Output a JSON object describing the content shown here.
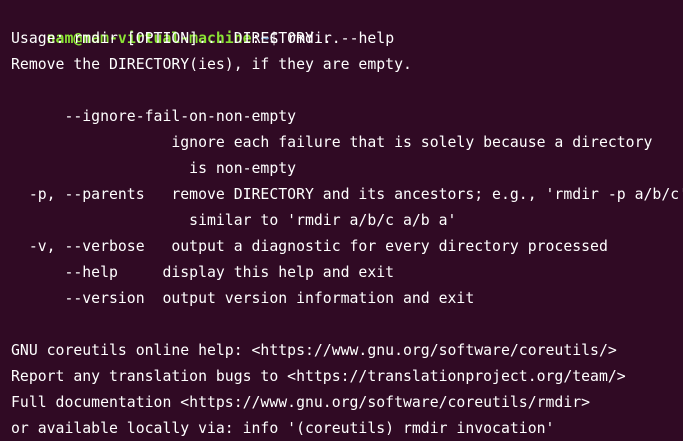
{
  "prompt": {
    "user_host": "nam@nam-virtual-machine",
    "separator": ":",
    "path": "~",
    "symbol": "$",
    "command": " rmdir --help"
  },
  "output_lines": [
    "Usage: rmdir [OPTION]... DIRECTORY...",
    "Remove the DIRECTORY(ies), if they are empty.",
    "",
    "      --ignore-fail-on-non-empty",
    "                  ignore each failure that is solely because a directory",
    "                    is non-empty",
    "  -p, --parents   remove DIRECTORY and its ancestors; e.g., 'rmdir -p a/b/c' is",
    "                    similar to 'rmdir a/b/c a/b a'",
    "  -v, --verbose   output a diagnostic for every directory processed",
    "      --help     display this help and exit",
    "      --version  output version information and exit",
    "",
    "GNU coreutils online help: <https://www.gnu.org/software/coreutils/>",
    "Report any translation bugs to <https://translationproject.org/team/>",
    "Full documentation <https://www.gnu.org/software/coreutils/rmdir>",
    "or available locally via: info '(coreutils) rmdir invocation'"
  ],
  "colors": {
    "background": "#300a24",
    "text": "#ffffff",
    "user_host": "#8ae234",
    "path": "#729fcf"
  }
}
